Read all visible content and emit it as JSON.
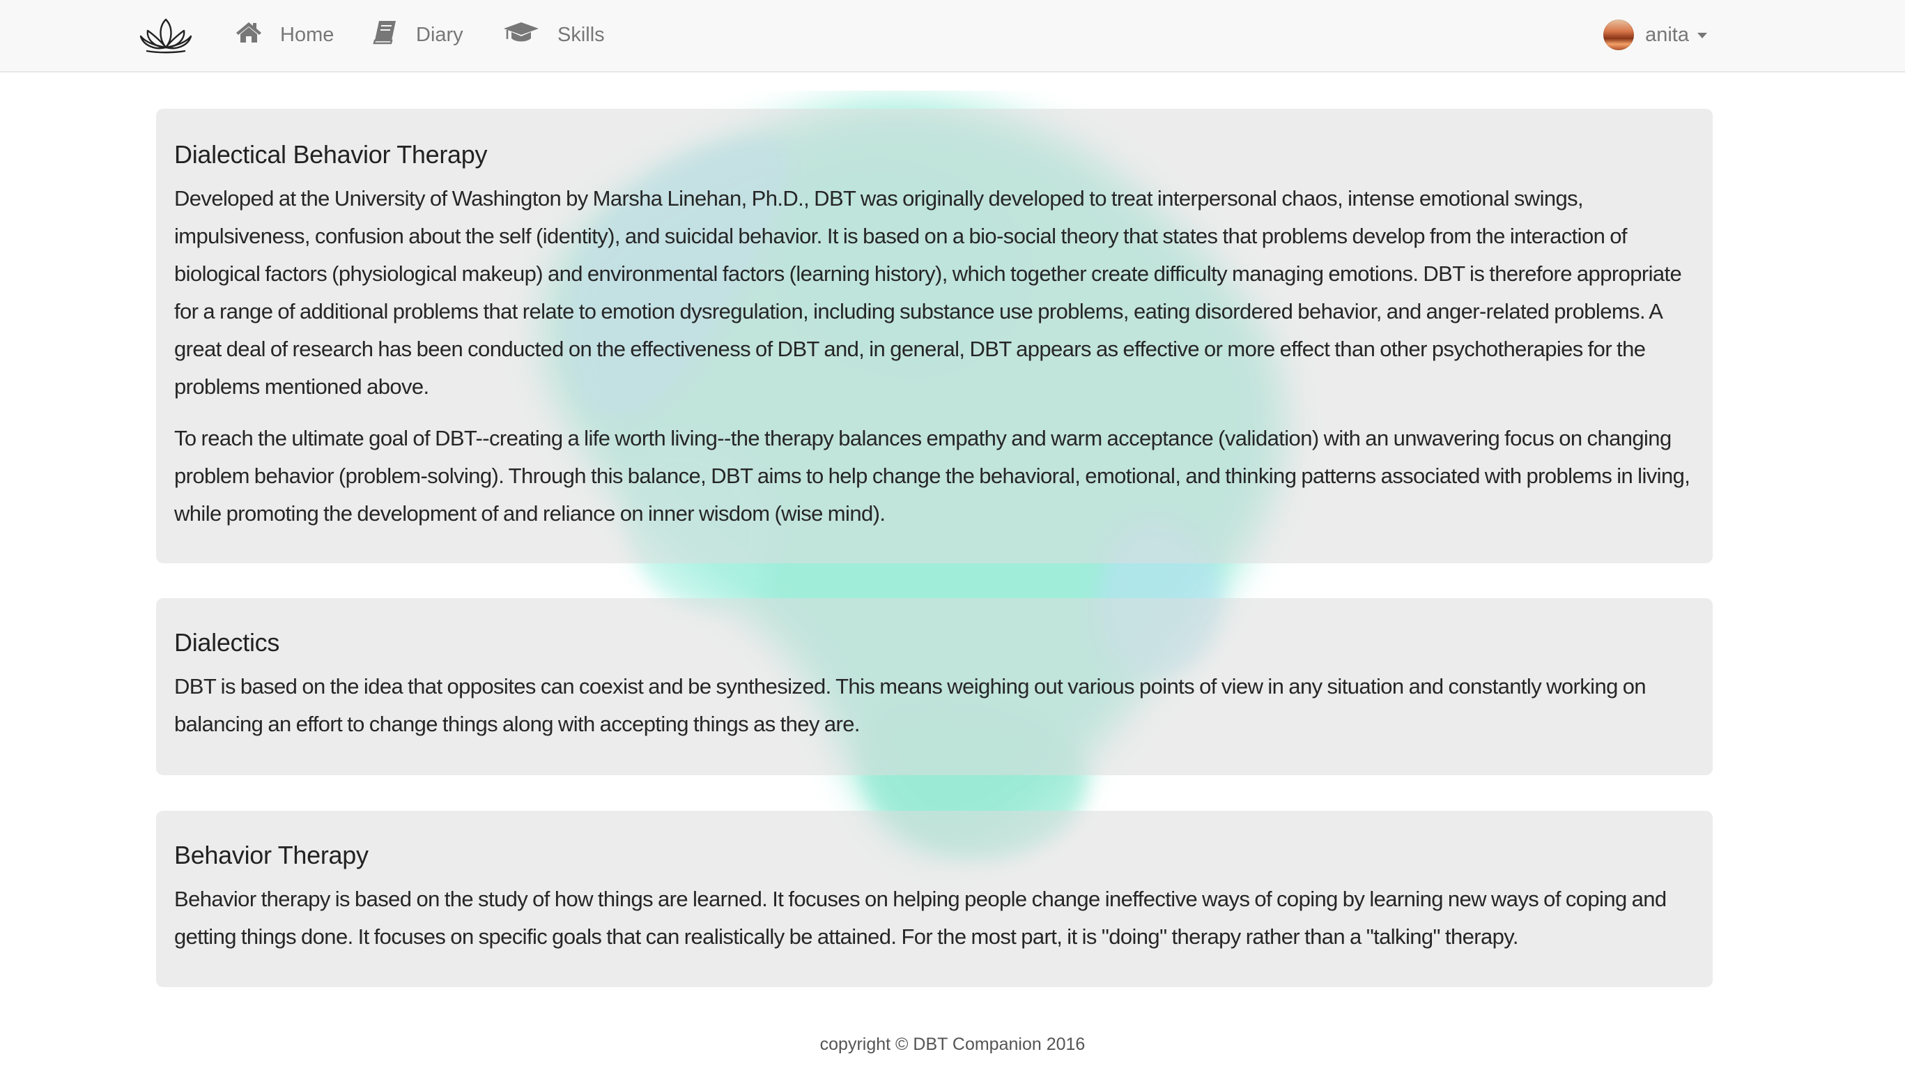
{
  "navbar": {
    "logo": "lotus-logo",
    "items": [
      {
        "label": "Home",
        "icon": "home-icon"
      },
      {
        "label": "Diary",
        "icon": "book-icon"
      },
      {
        "label": "Skills",
        "icon": "graduation-cap-icon"
      }
    ],
    "user": {
      "name": "anita",
      "avatar": "user-avatar",
      "menu_icon": "caret-down-icon"
    }
  },
  "colors": {
    "navbar_bg": "#f8f8f8",
    "panel_bg": "#e6e6e6",
    "watercolor_primary": "#7fe6cc",
    "watercolor_secondary": "#9ad8ee"
  },
  "sections": [
    {
      "title": "Dialectical Behavior Therapy",
      "paragraphs": [
        "Developed at the University of Washington by Marsha Linehan, Ph.D., DBT was originally developed to treat interpersonal chaos, intense emotional swings, impulsiveness, confusion about the self (identity), and suicidal behavior. It is based on a bio-social theory that states that problems develop from the interaction of biological factors (physiological makeup) and environmental factors (learning history), which together create difficulty managing emotions. DBT is therefore appropriate for a range of additional problems that relate to emotion dysregulation, including substance use problems, eating disordered behavior, and anger-related problems. A great deal of research has been conducted on the effectiveness of DBT and, in general, DBT appears as effective or more effect than other psychotherapies for the problems mentioned above.",
        "To reach the ultimate goal of DBT--creating a life worth living--the therapy balances empathy and warm acceptance (validation) with an unwavering focus on changing problem behavior (problem-solving). Through this balance, DBT aims to help change the behavioral, emotional, and thinking patterns associated with problems in living, while promoting the development of and reliance on inner wisdom (wise mind)."
      ]
    },
    {
      "title": "Dialectics",
      "paragraphs": [
        "DBT is based on the idea that opposites can coexist and be synthesized. This means weighing out various points of view in any situation and constantly working on balancing an effort to change things along with accepting things as they are."
      ]
    },
    {
      "title": "Behavior Therapy",
      "paragraphs": [
        "Behavior therapy is based on the study of how things are learned. It focuses on helping people change ineffective ways of coping by learning new ways of coping and getting things done. It focuses on specific goals that can realistically be attained. For the most part, it is \"doing\" therapy rather than a \"talking\" therapy."
      ]
    }
  ],
  "footer": {
    "text": "copyright © DBT Companion 2016"
  }
}
